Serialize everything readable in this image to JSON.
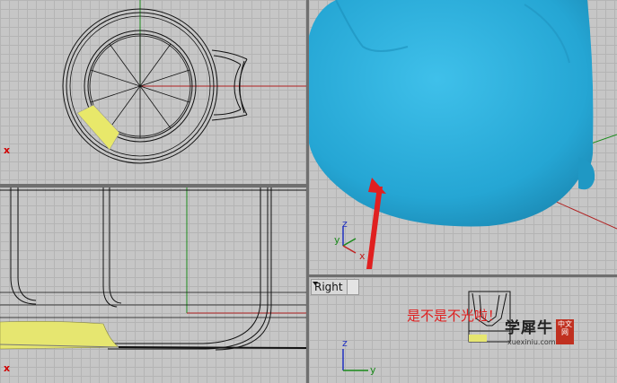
{
  "viewports": {
    "top": {
      "axis_marker": "x"
    },
    "front": {
      "axis_marker": "x"
    },
    "perspective": {
      "axis_labels": {
        "z": "z",
        "y": "y",
        "x": "x"
      }
    },
    "right": {
      "label": "Right",
      "axis_labels": {
        "z": "z",
        "y": "y"
      }
    }
  },
  "annotation": {
    "text": "是不是不光啦！"
  },
  "watermark": {
    "name": "学犀牛",
    "badge": "中文网",
    "url": "xuexiniu.com"
  },
  "colors": {
    "viewport_bg": "#c6c6c6",
    "grid": "#b4b4b4",
    "surface_blue": "#29a9d6",
    "highlight_yellow": "#e8e86a",
    "annotation_red": "#e02020",
    "x_axis": "#b02020",
    "y_axis": "#1a8a1a"
  },
  "icons": [
    "dropdown-arrow-icon",
    "axis-gizmo-icon",
    "red-arrow-pointer-icon"
  ]
}
